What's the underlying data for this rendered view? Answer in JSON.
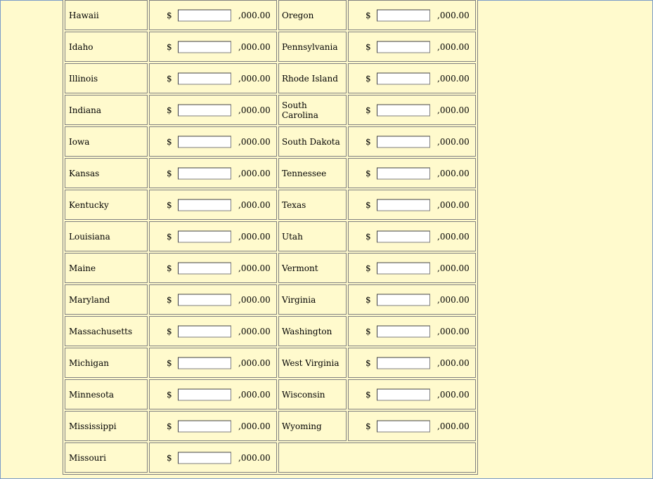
{
  "currency_symbol": "$",
  "amount_suffix": ",000.00",
  "rows": [
    {
      "left": "Hawaii",
      "right": "Oregon"
    },
    {
      "left": "Idaho",
      "right": "Pennsylvania"
    },
    {
      "left": "Illinois",
      "right": "Rhode Island"
    },
    {
      "left": "Indiana",
      "right": "South Carolina"
    },
    {
      "left": "Iowa",
      "right": "South Dakota"
    },
    {
      "left": "Kansas",
      "right": "Tennessee"
    },
    {
      "left": "Kentucky",
      "right": "Texas"
    },
    {
      "left": "Louisiana",
      "right": "Utah"
    },
    {
      "left": "Maine",
      "right": "Vermont"
    },
    {
      "left": "Maryland",
      "right": "Virginia"
    },
    {
      "left": "Massachusetts",
      "right": "Washington"
    },
    {
      "left": "Michigan",
      "right": "West Virginia"
    },
    {
      "left": "Minnesota",
      "right": "Wisconsin"
    },
    {
      "left": "Mississippi",
      "right": "Wyoming"
    },
    {
      "left": "Missouri",
      "right": null
    }
  ],
  "input_values": {
    "left": [
      "",
      "",
      "",
      "",
      "",
      "",
      "",
      "",
      "",
      "",
      "",
      "",
      "",
      "",
      ""
    ],
    "right": [
      "",
      "",
      "",
      "",
      "",
      "",
      "",
      "",
      "",
      "",
      "",
      "",
      "",
      ""
    ]
  }
}
